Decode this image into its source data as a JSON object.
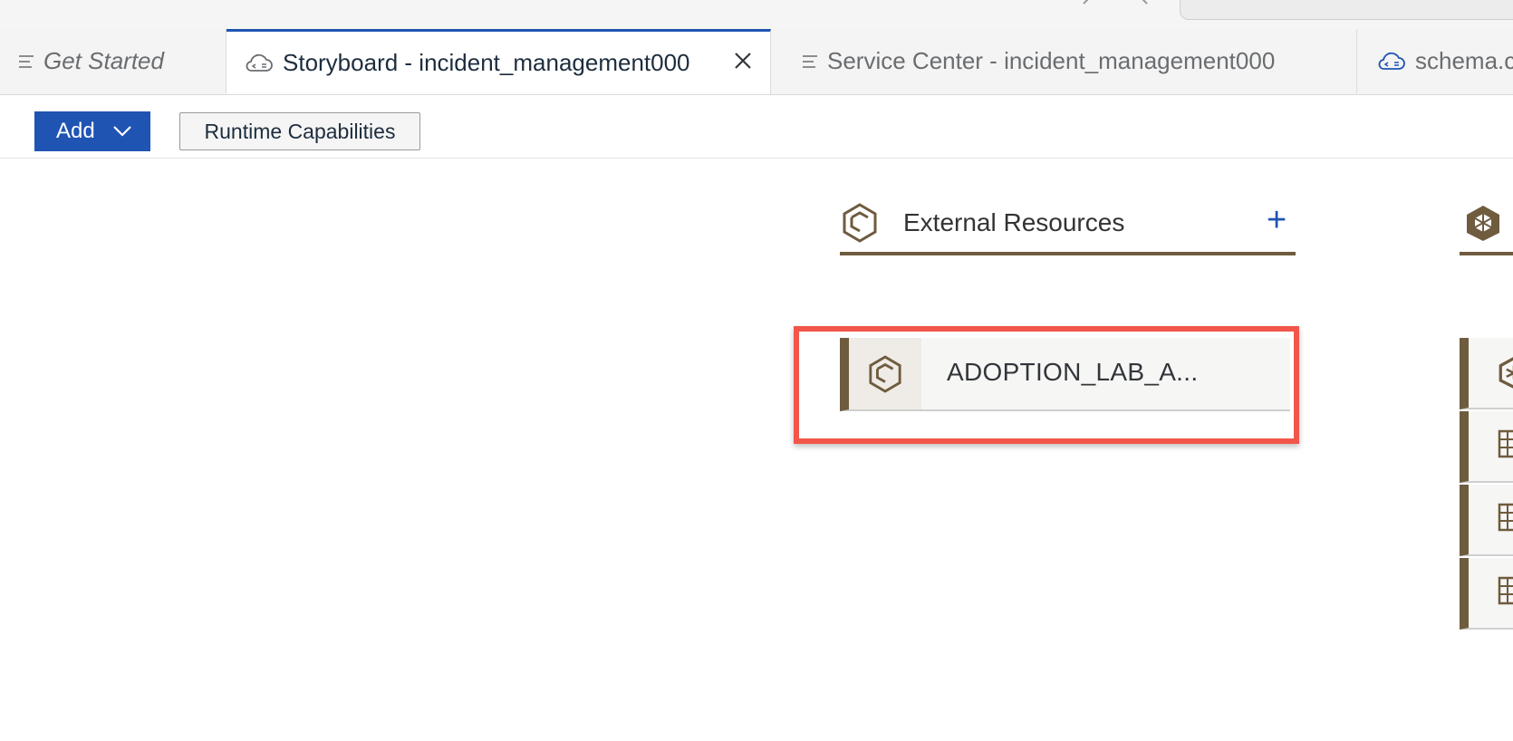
{
  "tabs": [
    {
      "label": "Get Started",
      "icon": "lines-icon"
    },
    {
      "label": "Storyboard - incident_management000",
      "icon": "cloud-code-icon",
      "active": true
    },
    {
      "label": "Service Center - incident_management000",
      "icon": "lines-icon"
    },
    {
      "label": "schema.c",
      "icon": "cloud-code-icon"
    }
  ],
  "toolbar": {
    "add_label": "Add",
    "runtime_label": "Runtime Capabilities"
  },
  "external_resources": {
    "title": "External Resources",
    "items": [
      {
        "label": "ADOPTION_LAB_A..."
      }
    ]
  },
  "colors": {
    "accent": "#1f54b3",
    "brown": "#6f5b3e",
    "highlight": "#f2564b"
  }
}
